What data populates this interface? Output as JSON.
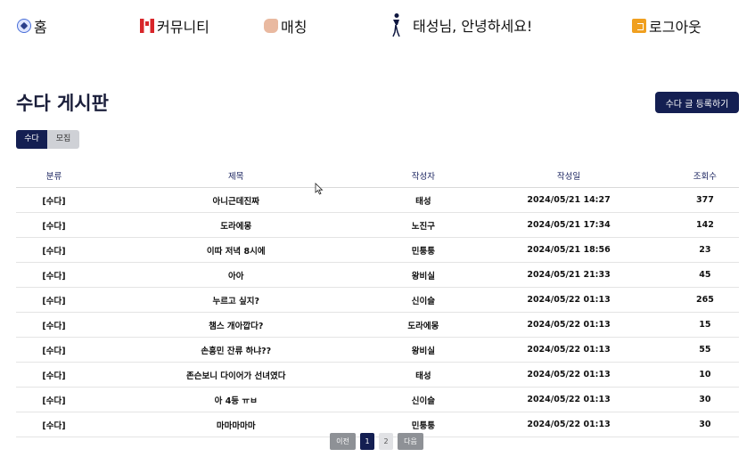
{
  "nav": {
    "home": "홈",
    "community": "커뮤니티",
    "matching": "매칭",
    "greeting": "태성님, 안녕하세요!",
    "logout": "로그아웃"
  },
  "board": {
    "title": "수다 게시판",
    "register_button": "수다 글 등록하기",
    "tabs": [
      "수다",
      "모집"
    ],
    "active_tab": "수다",
    "columns": [
      "분류",
      "제목",
      "작성자",
      "작성일",
      "조회수"
    ],
    "rows": [
      {
        "category": "[수다]",
        "title": "아니근데진짜",
        "author": "태성",
        "date": "2024/05/21 14:27",
        "views": "377"
      },
      {
        "category": "[수다]",
        "title": "도라에몽",
        "author": "노진구",
        "date": "2024/05/21 17:34",
        "views": "142"
      },
      {
        "category": "[수다]",
        "title": "이따 저녁 8시에",
        "author": "민퉁퉁",
        "date": "2024/05/21 18:56",
        "views": "23"
      },
      {
        "category": "[수다]",
        "title": "아아",
        "author": "왕비실",
        "date": "2024/05/21 21:33",
        "views": "45"
      },
      {
        "category": "[수다]",
        "title": "누르고 싶지?",
        "author": "신이슬",
        "date": "2024/05/22 01:13",
        "views": "265"
      },
      {
        "category": "[수다]",
        "title": "챔스 개아깝다?",
        "author": "도라에몽",
        "date": "2024/05/22 01:13",
        "views": "15"
      },
      {
        "category": "[수다]",
        "title": "손흥민 잔류 하냐??",
        "author": "왕비실",
        "date": "2024/05/22 01:13",
        "views": "55"
      },
      {
        "category": "[수다]",
        "title": "존슨보니 다이어가 선녀였다",
        "author": "태성",
        "date": "2024/05/22 01:13",
        "views": "10"
      },
      {
        "category": "[수다]",
        "title": "아 4등 ㅠㅂ",
        "author": "신이슬",
        "date": "2024/05/22 01:13",
        "views": "30"
      },
      {
        "category": "[수다]",
        "title": "마마마마마",
        "author": "민퉁퉁",
        "date": "2024/05/22 01:13",
        "views": "30"
      }
    ]
  },
  "pagination": {
    "prev": "이전",
    "pages": [
      "1",
      "2"
    ],
    "current": "1",
    "next": "다음"
  },
  "colors": {
    "primary": "#141f52",
    "muted_button": "#8e9196",
    "idle_tab": "#cfd1d6"
  },
  "icons": {
    "home": "soccer-ball-icon",
    "community": "canada-flag-icon",
    "matching": "handshake-icon",
    "greeting": "club-crest-icon",
    "logout": "logout-icon"
  }
}
